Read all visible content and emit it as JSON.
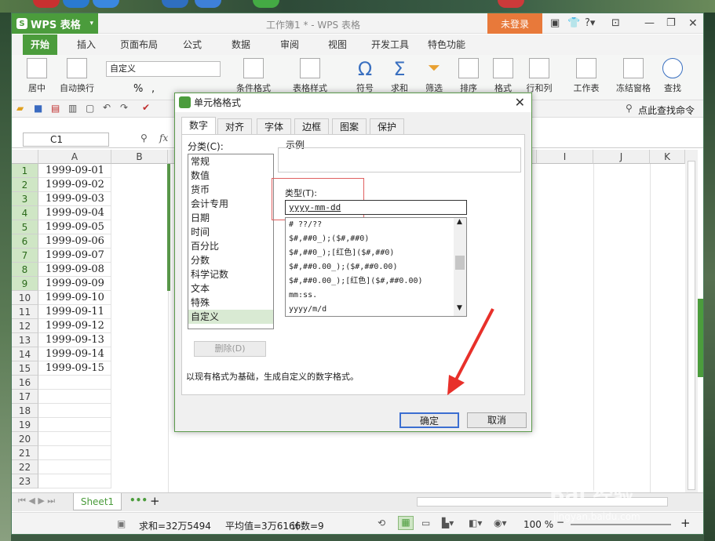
{
  "titlebar": {
    "app": "WPS 表格",
    "doc_title": "工作簿1 * - WPS 表格",
    "login": "未登录"
  },
  "tabs": [
    "开始",
    "插入",
    "页面布局",
    "公式",
    "数据",
    "审阅",
    "视图",
    "开发工具",
    "特色功能"
  ],
  "ribbon": {
    "merge": "居中",
    "wrap": "自动换行",
    "number_format": "自定义",
    "percent": "%",
    "comma": ",",
    "cond": "条件格式",
    "style": "表格样式",
    "symbol": "符号",
    "sum": "求和",
    "filter": "筛选",
    "sort": "排序",
    "format": "格式",
    "rowcol": "行和列",
    "sheet": "工作表",
    "freeze": "冻结窗格",
    "find": "查找"
  },
  "quick": {
    "search": "点此查找命令"
  },
  "namebox": "C1",
  "fx": "fx",
  "columns": [
    "A",
    "B",
    "I",
    "J",
    "K"
  ],
  "rows": [
    "1",
    "2",
    "3",
    "4",
    "5",
    "6",
    "7",
    "8",
    "9",
    "10",
    "11",
    "12",
    "13",
    "14",
    "15",
    "16",
    "17",
    "18",
    "19",
    "20",
    "21",
    "22",
    "23"
  ],
  "cells": [
    "1999-09-01",
    "1999-09-02",
    "1999-09-03",
    "1999-09-04",
    "1999-09-05",
    "1999-09-06",
    "1999-09-07",
    "1999-09-08",
    "1999-09-09",
    "1999-09-10",
    "1999-09-11",
    "1999-09-12",
    "1999-09-13",
    "1999-09-14",
    "1999-09-15"
  ],
  "sheet": "Sheet1",
  "status": {
    "sum": "求和=32万5494",
    "avg": "平均值=3万6166",
    "count": "计数=9",
    "zoom": "100 %"
  },
  "dialog": {
    "title": "单元格格式",
    "tabs": [
      "数字",
      "对齐",
      "字体",
      "边框",
      "图案",
      "保护"
    ],
    "category_label": "分类(C):",
    "categories": [
      "常规",
      "数值",
      "货币",
      "会计专用",
      "日期",
      "时间",
      "百分比",
      "分数",
      "科学记数",
      "文本",
      "特殊",
      "自定义"
    ],
    "example_label": "示例",
    "type_label": "类型(T):",
    "type_value": "yyyy-mm-dd",
    "formats": [
      "# ??/??",
      "$#,##0_);($#,##0)",
      "$#,##0_);[红色]($#,##0)",
      "$#,##0.00_);($#,##0.00)",
      "$#,##0.00_);[红色]($#,##0.00)",
      "mm:ss.",
      "yyyy/m/d"
    ],
    "delete": "删除(D)",
    "description": "以现有格式为基础，生成自定义的数字格式。",
    "ok": "确定",
    "cancel": "取消"
  },
  "watermark": "Bai 经验",
  "watermark_url": "jingyan.baidu.com"
}
